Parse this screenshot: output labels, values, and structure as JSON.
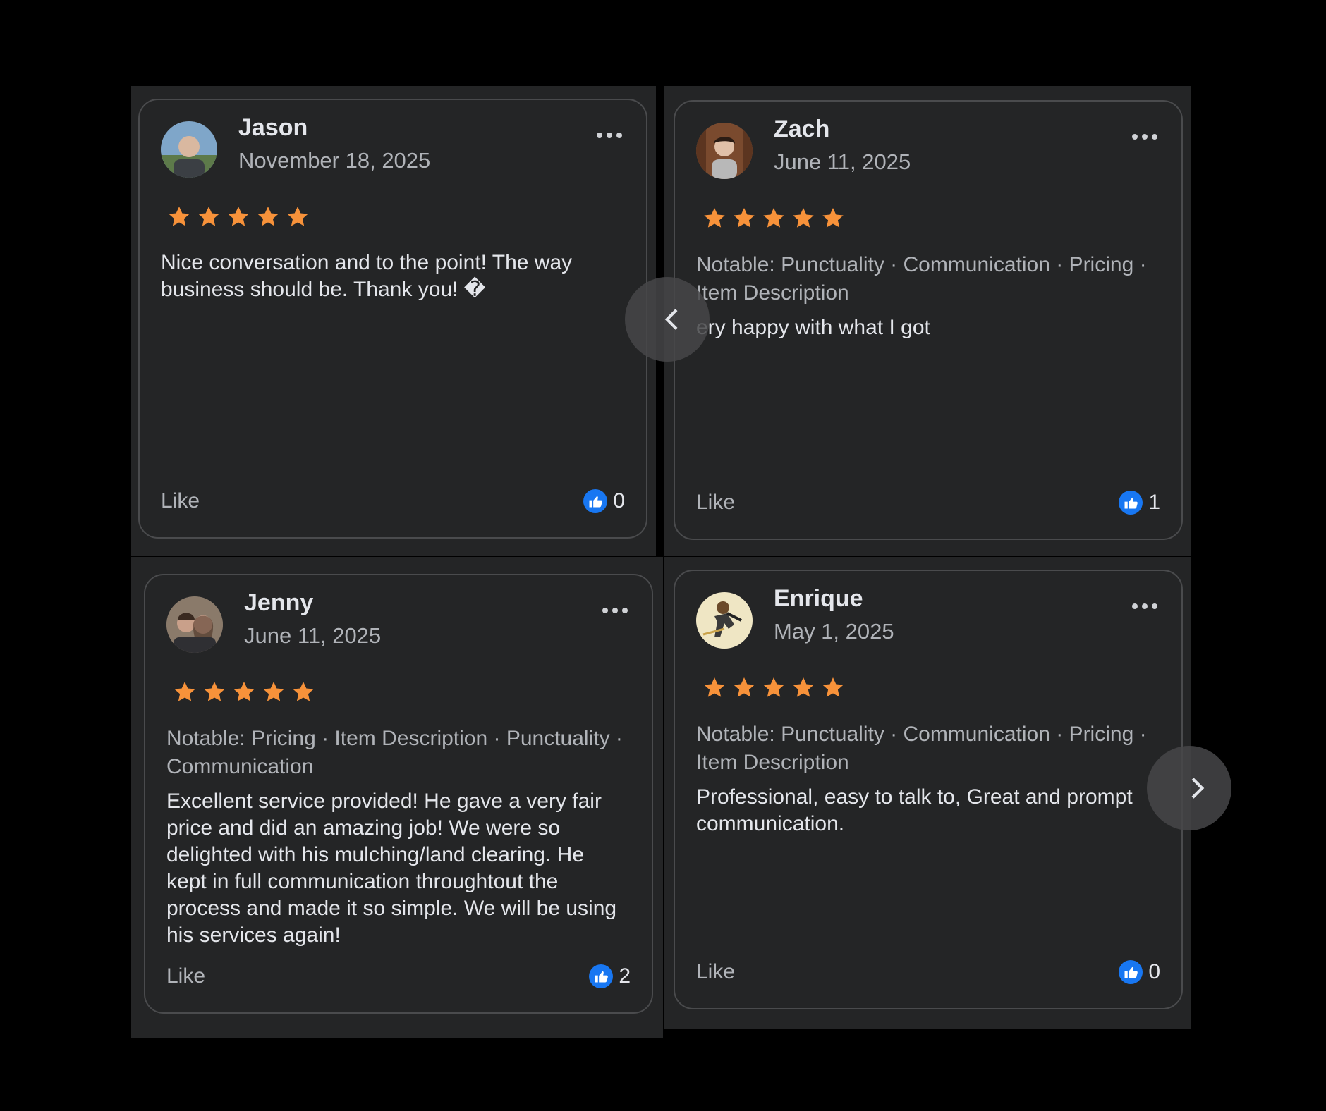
{
  "reviews": [
    {
      "name": "Jason",
      "date": "November 18, 2025",
      "rating": 5,
      "notable": "",
      "text": "Nice conversation and to the point! The way business should be. Thank you! �",
      "like_label": "Like",
      "like_count": "0",
      "avatar": "avatar-jason"
    },
    {
      "name": "Zach",
      "date": "June 11, 2025",
      "rating": 5,
      "notable": "Notable: Punctuality · Communication · Pricing · Item Description",
      "text": "ery happy with what I got",
      "like_label": "Like",
      "like_count": "1",
      "avatar": "avatar-zach"
    },
    {
      "name": "Jenny",
      "date": "June 11, 2025",
      "rating": 5,
      "notable": "Notable: Pricing · Item Description · Punctuality · Communication",
      "text": "Excellent service provided! He gave a very fair price and did an amazing job! We were so delighted with his mulching/land clearing. He kept in full communication throughtout the process and made it so simple. We will be using his services again!",
      "like_label": "Like",
      "like_count": "2",
      "avatar": "avatar-jenny"
    },
    {
      "name": "Enrique",
      "date": "May 1, 2025",
      "rating": 5,
      "notable": "Notable: Punctuality · Communication · Pricing · Item Description",
      "text": "Professional, easy to talk to, Great and prompt communication.",
      "like_label": "Like",
      "like_count": "0",
      "avatar": "avatar-enrique"
    }
  ],
  "icons": {
    "star": "star-icon",
    "more": "more-options-icon",
    "like": "thumbs-up-icon",
    "prev": "chevron-left-icon",
    "next": "chevron-right-icon"
  },
  "colors": {
    "star": "#f7923a",
    "like_badge": "#1877f2",
    "card_bg": "#242526",
    "page_bg": "#000000"
  }
}
